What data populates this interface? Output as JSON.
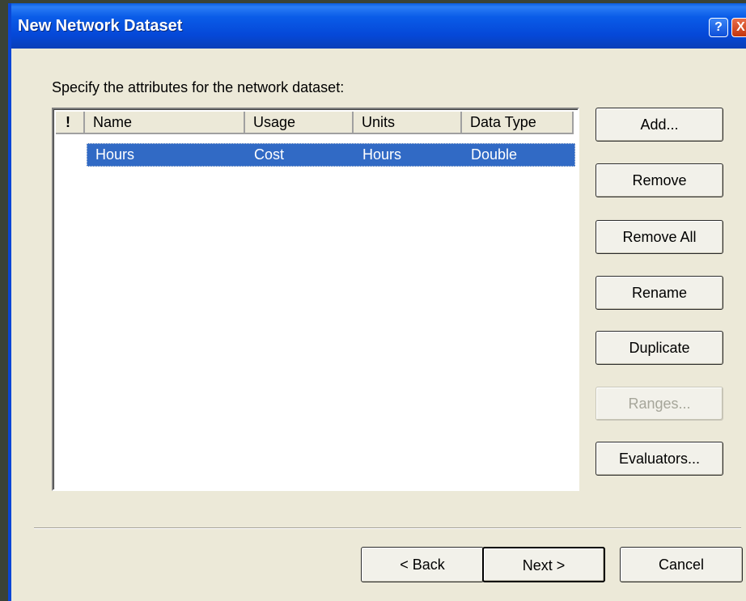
{
  "window": {
    "title": "New Network Dataset",
    "help_label": "?",
    "close_label": "X"
  },
  "instruction": "Specify the attributes for the network dataset:",
  "table": {
    "columns": [
      "!",
      "Name",
      "Usage",
      "Units",
      "Data Type"
    ],
    "rows": [
      {
        "name": "Hours",
        "usage": "Cost",
        "units": "Hours",
        "data_type": "Double",
        "selected": true
      }
    ]
  },
  "side_buttons": {
    "add": "Add...",
    "remove": "Remove",
    "remove_all": "Remove All",
    "rename": "Rename",
    "duplicate": "Duplicate",
    "ranges": "Ranges...",
    "evaluators": "Evaluators..."
  },
  "footer": {
    "back": "< Back",
    "next": "Next >",
    "cancel": "Cancel"
  },
  "colors": {
    "title_bar": "#0548d8",
    "selection": "#316ac5",
    "dialog_bg": "#ece9d8"
  }
}
